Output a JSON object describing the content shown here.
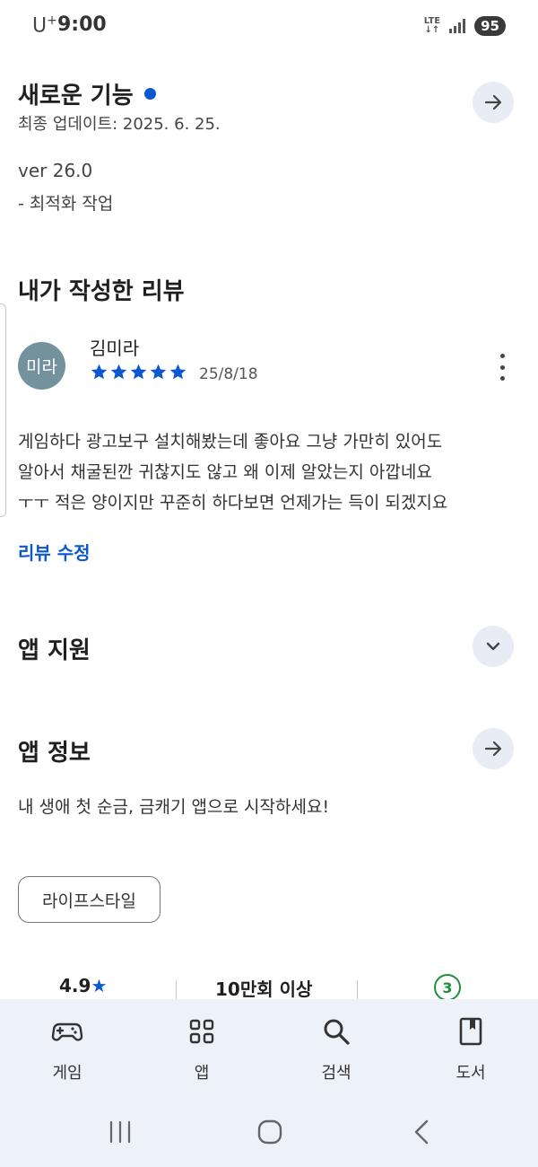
{
  "status_bar": {
    "carrier": "U",
    "carrier_sup": "+",
    "time": "9:00",
    "network": "LTE",
    "battery": "95"
  },
  "whats_new": {
    "title": "새로운 기능",
    "last_updated": "최종 업데이트: 2025. 6. 25.",
    "version": "ver 26.0",
    "note": "- 최적화 작업"
  },
  "my_review": {
    "title": "내가 작성한 리뷰",
    "avatar_text": "미라",
    "reviewer": "김미라",
    "rating": 5,
    "max_rating": 5,
    "date": "25/8/18",
    "lines": [
      "게임하다 광고보구 설치해봤는데 좋아요 그냥 가만히 있어도",
      "알아서 채굴된깐 귀찮지도 않고 왜 이제 알았는지 아깝네요",
      "ㅜㅜ 적은 양이지만 꾸준히 하다보면 언제가는 득이 되겠지요"
    ],
    "edit_label": "리뷰 수정"
  },
  "app_support": {
    "title": "앱 지원"
  },
  "app_info": {
    "title": "앱 정보",
    "description": "내 생애 첫 순금, 금캐기 앱으로 시작하세요!",
    "category_chip": "라이프스타일"
  },
  "stats": {
    "rating": "4.9",
    "star_glyph": "★",
    "downloads": "10만회 이상",
    "age_rating": "3"
  },
  "bottom_nav": {
    "items": [
      {
        "label": "게임",
        "icon": "gamepad-icon"
      },
      {
        "label": "앱",
        "icon": "apps-grid-icon"
      },
      {
        "label": "검색",
        "icon": "search-icon"
      },
      {
        "label": "도서",
        "icon": "book-icon"
      }
    ]
  },
  "colors": {
    "accent": "#0b57d0",
    "avatar_bg": "#74919e",
    "nav_bg": "#edf1f8",
    "button_bg": "#e8ecf5",
    "age_badge": "#1e8e3e"
  }
}
